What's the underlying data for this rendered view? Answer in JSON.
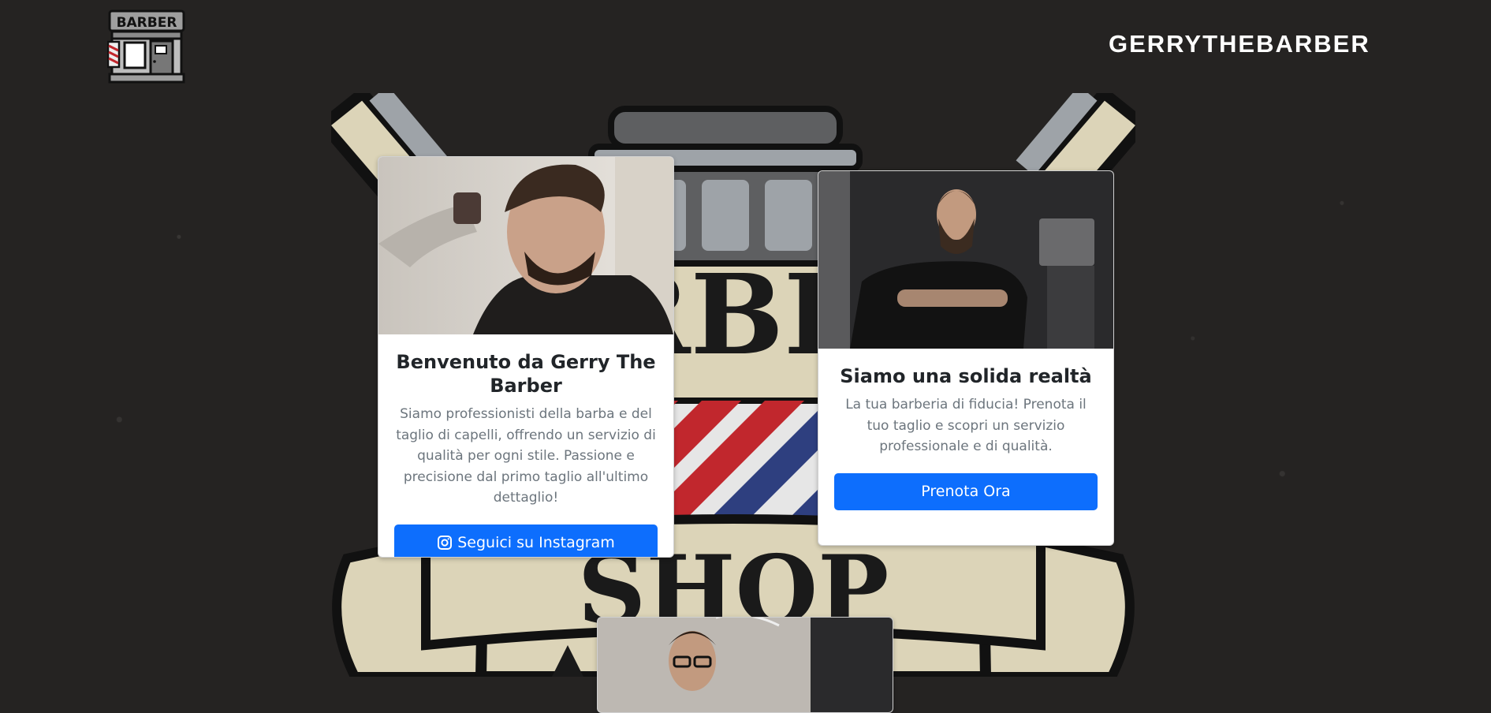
{
  "header": {
    "brand": "GERRYTHEBARBER",
    "logo_text": "BARBER"
  },
  "emblem": {
    "text_top": "RBE",
    "text_bottom": "SHOP"
  },
  "cards": [
    {
      "title": "Benvenuto da Gerry The Barber",
      "text": "Siamo professionisti della barba e del taglio di capelli, offrendo un servizio di qualità per ogni stile. Passione e precisione dal primo taglio all'ultimo dettaglio!",
      "button_label": "Seguici su Instagram",
      "button_icon": "instagram-icon"
    },
    {
      "title": "Siamo una solida realtà",
      "text": "La tua barberia di fiducia! Prenota il tuo taglio e scopri un servizio professionale e di qualità.",
      "button_label": "Prenota Ora"
    }
  ],
  "colors": {
    "background": "#252322",
    "button": "#0d6efd",
    "emblem_cream": "#dcd4b8",
    "pole_red": "#c1272d",
    "pole_blue": "#2e3f7f"
  }
}
